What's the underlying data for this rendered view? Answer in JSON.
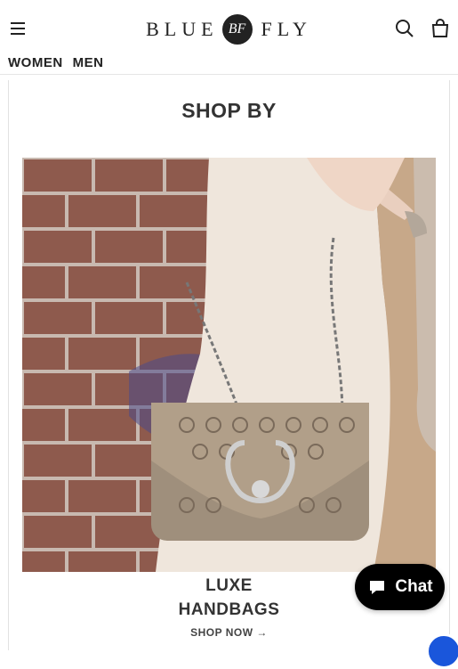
{
  "header": {
    "logo_left": "BLUE",
    "logo_mark": "BF",
    "logo_right": "FLY"
  },
  "nav": {
    "items": [
      "WOMEN",
      "MEN"
    ]
  },
  "section": {
    "title": "SHOP BY"
  },
  "promo": {
    "title_line1": "LUXE",
    "title_line2": "HANDBAGS",
    "cta": "SHOP NOW →",
    "image_icon": "handbag-photo"
  },
  "chat": {
    "label": "Chat",
    "icon": "chat-bubble-icon"
  },
  "colors": {
    "chat_bg": "#000000",
    "accessibility_bg": "#1a56db",
    "text": "#333333"
  }
}
